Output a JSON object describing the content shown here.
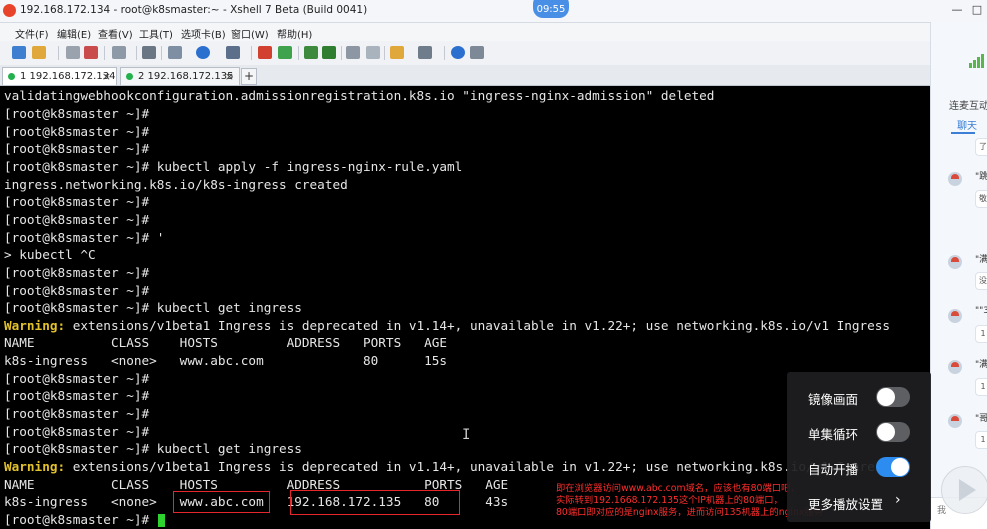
{
  "window": {
    "title": "192.168.172.134 - root@k8smaster:~ - Xshell 7 Beta (Build 0041)",
    "clock": "09:55",
    "controls": [
      "—",
      "□"
    ]
  },
  "menu": [
    "文件(F)",
    "编辑(E)",
    "查看(V)",
    "工具(T)",
    "选项卡(B)",
    "窗口(W)",
    "帮助(H)"
  ],
  "tabs": [
    {
      "label": "1 192.168.172.134",
      "close": "×"
    },
    {
      "label": "2 192.168.172.135",
      "close": "×"
    }
  ],
  "add_tab": "+",
  "terminal": {
    "lines": [
      {
        "text": "validatingwebhookconfiguration.admissionregistration.k8s.io \"ingress-nginx-admission\" deleted"
      },
      {
        "text": "[root@k8smaster ~]#"
      },
      {
        "text": "[root@k8smaster ~]#"
      },
      {
        "text": "[root@k8smaster ~]#"
      },
      {
        "text": "[root@k8smaster ~]# kubectl apply -f ingress-nginx-rule.yaml"
      },
      {
        "text": "ingress.networking.k8s.io/k8s-ingress created"
      },
      {
        "text": "[root@k8smaster ~]#"
      },
      {
        "text": "[root@k8smaster ~]#"
      },
      {
        "text": "[root@k8smaster ~]# '"
      },
      {
        "text": "> kubectl ^C"
      },
      {
        "text": "[root@k8smaster ~]#"
      },
      {
        "text": "[root@k8smaster ~]#"
      },
      {
        "text": "[root@k8smaster ~]# kubectl get ingress"
      },
      {
        "warn": "Warning:",
        "text": " extensions/v1beta1 Ingress is deprecated in v1.14+, unavailable in v1.22+; use networking.k8s.io/v1 Ingress"
      },
      {
        "text": "NAME          CLASS    HOSTS         ADDRESS   PORTS   AGE"
      },
      {
        "text": "k8s-ingress   <none>   www.abc.com             80      15s"
      },
      {
        "text": "[root@k8smaster ~]#"
      },
      {
        "text": "[root@k8smaster ~]#"
      },
      {
        "text": "[root@k8smaster ~]#"
      },
      {
        "text": "[root@k8smaster ~]#"
      },
      {
        "text": "[root@k8smaster ~]# kubectl get ingress"
      },
      {
        "warn": "Warning:",
        "text": " extensions/v1beta1 Ingress is deprecated in v1.14+, unavailable in v1.22+; use networking.k8s.io/v1 Ingress"
      },
      {
        "text": "NAME          CLASS    HOSTS         ADDRESS           PORTS   AGE"
      },
      {
        "text": "k8s-ingress   <none>   www.abc.com   192.168.172.135   80      43s"
      },
      {
        "text": "[root@k8smaster ~]# "
      }
    ],
    "annotation": [
      "即在浏览器访问www.abc.com域名，应该也有80端口吧，",
      "实际转到192.1668.172.135这个IP机器上的80端口，",
      "80端口即对应的是nginx服务，进而访问135机器上的nginx服务"
    ]
  },
  "sidepanel": {
    "header": "连麦互动",
    "tab": "聊天",
    "messages": [
      {
        "text": "\"跳",
        "reply": "敬"
      },
      {
        "text": "\"满",
        "reply": "没"
      },
      {
        "text": "\"\"3",
        "reply": "1"
      },
      {
        "text": "\"满",
        "reply": "1"
      },
      {
        "text": "\"哥",
        "reply": "1"
      }
    ],
    "top_reply": "了",
    "input_text": "我"
  },
  "playback": {
    "items": [
      {
        "label": "镜像画面",
        "on": false
      },
      {
        "label": "单集循环",
        "on": false
      },
      {
        "label": "自动开播",
        "on": true
      }
    ],
    "more_label": "更多播放设置",
    "more_arrow": "›"
  }
}
